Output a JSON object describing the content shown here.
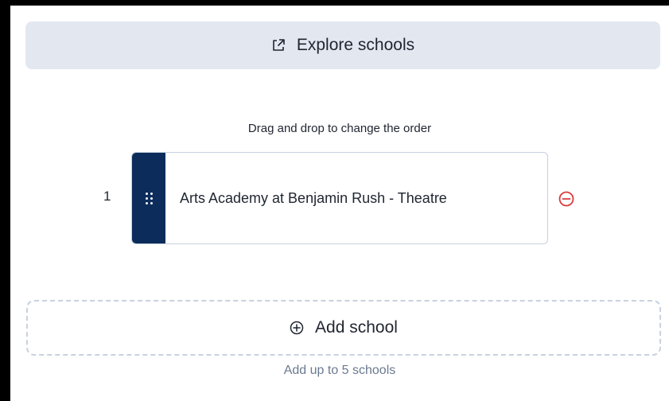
{
  "explore": {
    "label": "Explore schools",
    "icon": "external-link-icon"
  },
  "ranking": {
    "hint": "Drag and drop to change the order",
    "items": [
      {
        "rank": "1",
        "name": "Arts Academy at Benjamin Rush - Theatre",
        "handle_icon": "drag-handle-icon",
        "remove_icon": "minus-circle-icon"
      }
    ]
  },
  "add": {
    "label": "Add school",
    "icon": "plus-circle-icon",
    "note": "Add up to 5 schools"
  },
  "colors": {
    "explore_bg": "#e3e7f0",
    "handle_bg": "#0c2d5b",
    "remove_red": "#d93a3a",
    "dashed_border": "#c9d1de",
    "muted_text": "#6b7a90"
  }
}
